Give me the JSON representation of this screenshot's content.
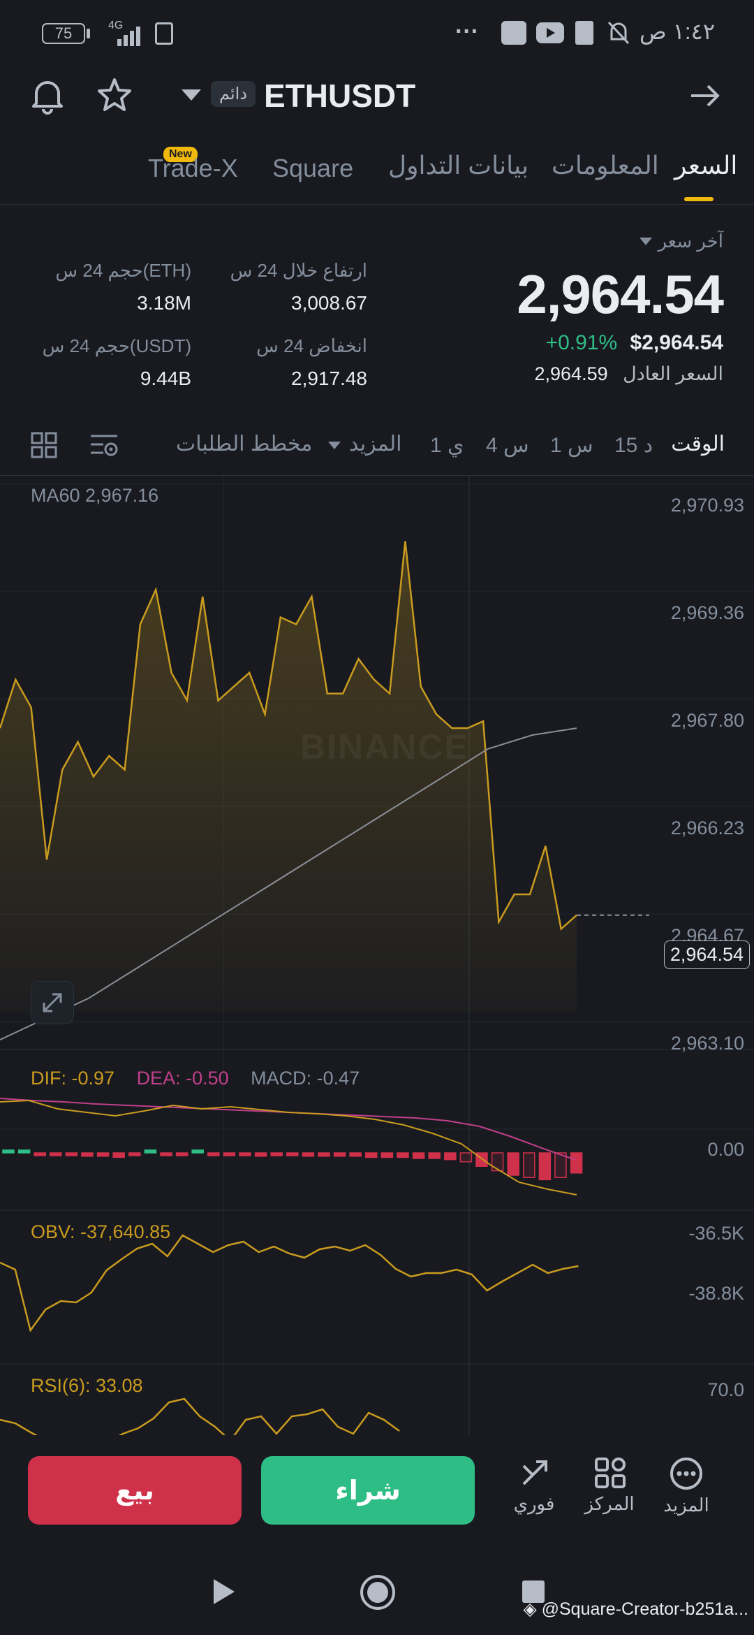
{
  "status_bar": {
    "time": "١:٤٢ ص",
    "battery": "75",
    "network": "4G",
    "dots": "···"
  },
  "header": {
    "symbol": "ETHUSDT",
    "contract_type": "دائم"
  },
  "tabs": [
    {
      "label": "السعر",
      "active": true
    },
    {
      "label": "المعلومات"
    },
    {
      "label": "بيانات التداول"
    },
    {
      "label": "Square"
    },
    {
      "label": "Trade-X",
      "badge": "New"
    }
  ],
  "price": {
    "last_label": "آخر سعر",
    "last": "2,964.54",
    "usd": "$2,964.54",
    "change": "+0.91%",
    "fair_label": "السعر العادل",
    "fair": "2,964.59"
  },
  "stats": {
    "high_label": "ارتفاع خلال 24 س",
    "high": "3,008.67",
    "low_label": "انخفاض 24 س",
    "low": "2,917.48",
    "vol_eth_label": "حجم 24 س(ETH)",
    "vol_eth": "3.18M",
    "vol_usdt_label": "حجم 24 س(USDT)",
    "vol_usdt": "9.44B"
  },
  "intervals": {
    "time_label": "الوقت",
    "items": [
      "15 د",
      "1 س",
      "4 س",
      "1 ي"
    ],
    "more": "المزيد",
    "depth": "مخطط الطلبات"
  },
  "chart": {
    "ma_label": "MA60 2,967.16",
    "watermark": "BINANCE",
    "y_ticks": [
      "2,970.93",
      "2,969.36",
      "2,967.80",
      "2,966.23",
      "2,964.67",
      "2,963.10"
    ],
    "current_price_tag": "2,964.54",
    "colors": {
      "line": "#c99b1e",
      "ma": "#8a8f98",
      "up": "#2ebd85",
      "down": "#cf304a",
      "dif": "#c99b1e",
      "dea": "#c0408a"
    }
  },
  "chart_data": {
    "type": "line",
    "ylim": [
      2963.1,
      2970.93
    ],
    "price_series": [
      2967.7,
      2968.4,
      2968.0,
      2965.8,
      2967.1,
      2967.5,
      2967.0,
      2967.3,
      2967.1,
      2969.2,
      2969.7,
      2968.5,
      2968.1,
      2969.6,
      2968.1,
      2968.3,
      2968.5,
      2967.9,
      2969.3,
      2969.2,
      2969.6,
      2968.2,
      2968.2,
      2968.7,
      2968.4,
      2968.2,
      2970.4,
      2968.3,
      2967.9,
      2967.7,
      2967.7,
      2967.8,
      2964.9,
      2965.3,
      2965.3,
      2966.0,
      2964.8,
      2965.0
    ],
    "ma60_series": [
      2963.2,
      2963.5,
      2963.8,
      2964.2,
      2964.6,
      2965.0,
      2965.4,
      2965.8,
      2966.2,
      2966.6,
      2967.0,
      2967.4,
      2967.6,
      2967.7
    ],
    "macd": {
      "dif": "DIF: -0.97",
      "dea": "DEA: -0.50",
      "macd": "MACD: -0.47",
      "zero": "0.00"
    },
    "obv": {
      "label": "OBV: -37,640.85",
      "ticks": [
        "-36.5K",
        "-38.8K"
      ]
    },
    "rsi": {
      "label": "RSI(6): 33.08",
      "tick": "70.0"
    }
  },
  "actions": {
    "sell": "بيع",
    "buy": "شراء",
    "spot": "فوري",
    "center": "المركز",
    "more": "المزيد"
  },
  "watermark_footer": "@Square-Creator-b251a..."
}
